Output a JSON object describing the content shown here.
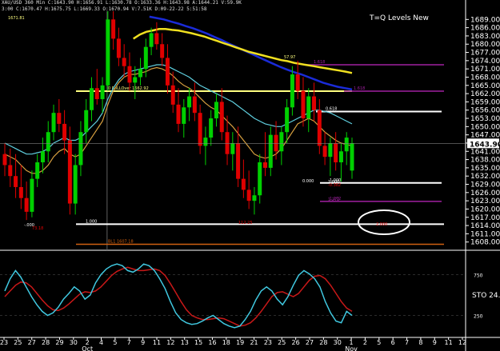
{
  "header": {
    "line1": "XAU/USD 360 Min  C:1643.90  H:1656.91  L:1630.78  O:1633.36  H:1643.98  A:1644.21  V:59.9K",
    "line2": "3:00  C:1670.47  H:1675.75  L:1669.33  O:1670.94  V:7.51K  D:09-22-22  5:51:58"
  },
  "title": "T=Q Levels New",
  "colors": {
    "background": "#000000",
    "bull": "#00d000",
    "bear": "#e00000",
    "ma_blue": "#1a2bd8",
    "ma_yellow": "#f0e020",
    "ma_orange": "#d8a040",
    "ma_cyan": "#60d0e0",
    "stoch_k": "#40c8e0",
    "stoch_d": "#c81818",
    "level_white": "#ffffff",
    "level_magenta": "#a020a0",
    "level_yellow": "#ffff80",
    "level_orange": "#d06010",
    "ellipse": "#ffffff",
    "grid": "#3a3a3a",
    "axis_text": "#ffffff",
    "price_box_bg": "#ffffff",
    "price_box_text": "#000000"
  },
  "chart_data": {
    "type": "candlestick",
    "y_axis": {
      "ticks": [
        1689,
        1686,
        1683,
        1680,
        1677,
        1674,
        1671,
        1668,
        1665,
        1662,
        1659,
        1656,
        1653,
        1650,
        1647,
        1644,
        1641,
        1638,
        1635,
        1632,
        1629,
        1626,
        1623,
        1620,
        1617,
        1614,
        1611,
        1608
      ],
      "tick_labels": [
        "1689.00",
        "1686.00",
        "1683.00",
        "1680.00",
        "1677.00",
        "1674.00",
        "1671.00",
        "1668.00",
        "1665.00",
        "1662.00",
        "1659.00",
        "1656.00",
        "1653.00",
        "1650.00",
        "1647.00",
        "1644.00",
        "1641.00",
        "1638.00",
        "1635.00",
        "1632.00",
        "1629.00",
        "1626.00",
        "1623.00",
        "1620.00",
        "1617.00",
        "1614.00",
        "1611.00",
        "1608.00"
      ],
      "range": [
        1605,
        1692
      ]
    },
    "x_axis": {
      "day_labels": [
        "23",
        "25",
        "27",
        "28",
        "29",
        "30",
        "2",
        "4",
        "5",
        "7",
        "9",
        "11",
        "12",
        "13",
        "15",
        "16",
        "18",
        "19",
        "21",
        "23",
        "25",
        "26",
        "27",
        "28",
        "30",
        "1",
        "2",
        "5",
        "6",
        "7",
        "8",
        "9",
        "11",
        "12"
      ],
      "month_labels": [
        "Oct",
        "Nov"
      ],
      "month_positions_day_index": [
        6,
        25
      ]
    },
    "last_price": "1643.90",
    "candles": [
      [
        1640,
        1644,
        1632,
        1636
      ],
      [
        1636,
        1642,
        1628,
        1632
      ],
      [
        1632,
        1640,
        1624,
        1628
      ],
      [
        1628,
        1636,
        1620,
        1624
      ],
      [
        1624,
        1630,
        1616,
        1619
      ],
      [
        1619,
        1634,
        1617,
        1631
      ],
      [
        1631,
        1640,
        1628,
        1637
      ],
      [
        1637,
        1646,
        1633,
        1641
      ],
      [
        1641,
        1652,
        1637,
        1648
      ],
      [
        1648,
        1658,
        1645,
        1655
      ],
      [
        1655,
        1660,
        1648,
        1651
      ],
      [
        1651,
        1656,
        1640,
        1645
      ],
      [
        1645,
        1650,
        1618,
        1622
      ],
      [
        1622,
        1640,
        1618,
        1636
      ],
      [
        1636,
        1652,
        1632,
        1648
      ],
      [
        1648,
        1660,
        1644,
        1656
      ],
      [
        1656,
        1668,
        1652,
        1664
      ],
      [
        1664,
        1671,
        1658,
        1660
      ],
      [
        1660,
        1668,
        1655,
        1665
      ],
      [
        1665,
        1692,
        1663,
        1689
      ],
      [
        1689,
        1692,
        1678,
        1682
      ],
      [
        1682,
        1686,
        1672,
        1675
      ],
      [
        1675,
        1680,
        1668,
        1672
      ],
      [
        1672,
        1677,
        1663,
        1666
      ],
      [
        1666,
        1672,
        1660,
        1668
      ],
      [
        1668,
        1675,
        1665,
        1671
      ],
      [
        1671,
        1682,
        1668,
        1679
      ],
      [
        1679,
        1686,
        1676,
        1684
      ],
      [
        1684,
        1688,
        1678,
        1680
      ],
      [
        1680,
        1684,
        1672,
        1675
      ],
      [
        1675,
        1680,
        1662,
        1665
      ],
      [
        1665,
        1670,
        1655,
        1658
      ],
      [
        1658,
        1664,
        1648,
        1651
      ],
      [
        1651,
        1660,
        1646,
        1657
      ],
      [
        1657,
        1664,
        1652,
        1661
      ],
      [
        1661,
        1666,
        1652,
        1655
      ],
      [
        1655,
        1658,
        1640,
        1643
      ],
      [
        1643,
        1650,
        1636,
        1646
      ],
      [
        1646,
        1656,
        1643,
        1653
      ],
      [
        1653,
        1662,
        1650,
        1659
      ],
      [
        1659,
        1664,
        1645,
        1648
      ],
      [
        1648,
        1654,
        1636,
        1640
      ],
      [
        1640,
        1648,
        1634,
        1644
      ],
      [
        1644,
        1650,
        1628,
        1631
      ],
      [
        1631,
        1638,
        1624,
        1627
      ],
      [
        1627,
        1634,
        1620,
        1623
      ],
      [
        1623,
        1628,
        1618,
        1625
      ],
      [
        1625,
        1640,
        1622,
        1637
      ],
      [
        1637,
        1648,
        1632,
        1635
      ],
      [
        1635,
        1650,
        1632,
        1647
      ],
      [
        1647,
        1652,
        1638,
        1641
      ],
      [
        1641,
        1650,
        1636,
        1648
      ],
      [
        1648,
        1660,
        1644,
        1657
      ],
      [
        1657,
        1672,
        1654,
        1669
      ],
      [
        1669,
        1674,
        1660,
        1663
      ],
      [
        1663,
        1668,
        1650,
        1653
      ],
      [
        1653,
        1664,
        1648,
        1661
      ],
      [
        1661,
        1666,
        1652,
        1656
      ],
      [
        1656,
        1660,
        1640,
        1643
      ],
      [
        1643,
        1648,
        1636,
        1639
      ],
      [
        1639,
        1646,
        1632,
        1644
      ],
      [
        1644,
        1648,
        1634,
        1637
      ],
      [
        1637,
        1644,
        1630,
        1641
      ],
      [
        1641,
        1648,
        1636,
        1646
      ],
      [
        1634,
        1646,
        1631,
        1644
      ]
    ],
    "moving_averages": [
      {
        "color_key": "ma_blue",
        "values": [
          null,
          null,
          null,
          null,
          null,
          null,
          null,
          null,
          null,
          null,
          null,
          null,
          null,
          null,
          null,
          null,
          null,
          null,
          null,
          null,
          1690,
          1689.5,
          1689,
          1688.2,
          1687.5,
          1686.6,
          1685.8,
          1684.8,
          1683.8,
          1682.6,
          1681.5,
          1680.2,
          1679,
          1677.8,
          1676.6,
          1675.4,
          1674.2,
          1673,
          1671.8,
          1670.8,
          1669.8,
          1669,
          1668,
          1667,
          1666,
          1665.2,
          1664.5,
          1664,
          1663.5
        ]
      },
      {
        "color_key": "ma_yellow",
        "values": [
          null,
          null,
          null,
          null,
          null,
          null,
          null,
          null,
          null,
          null,
          null,
          null,
          null,
          null,
          null,
          null,
          null,
          null,
          null,
          null,
          1682,
          1683.5,
          1684.5,
          1685,
          1685.5,
          1685.5,
          1685.2,
          1685,
          1684.5,
          1684,
          1683.4,
          1682.8,
          1682,
          1681.2,
          1680.4,
          1679.6,
          1678.8,
          1678,
          1677.2,
          1676.6,
          1676,
          1675.4,
          1674.8,
          1674.2,
          1673.8,
          1673.2,
          1672.8,
          1672.4,
          1672,
          1671.6,
          1671.2,
          1670.8,
          1670.4,
          1670,
          1669.5
        ]
      },
      {
        "color_key": "ma_cyan",
        "values": [
          1644,
          1643,
          1642,
          1641,
          1640,
          1640,
          1640.5,
          1641,
          1642,
          1644,
          1645,
          1646,
          1645,
          1645,
          1646,
          1648,
          1650,
          1652,
          1655,
          1660,
          1664,
          1667,
          1669,
          1670,
          1670.5,
          1671,
          1671.5,
          1672,
          1672.5,
          1672.5,
          1672,
          1671,
          1670,
          1669,
          1668,
          1666.5,
          1665,
          1664,
          1663,
          1662,
          1661,
          1660,
          1659,
          1657.5,
          1656,
          1654.5,
          1653,
          1652,
          1651,
          1650.5,
          1650,
          1650,
          1651,
          1652,
          1653,
          1654,
          1655,
          1656,
          1656,
          1655.5,
          1655,
          1654,
          1653,
          1652,
          1651
        ]
      },
      {
        "color_key": "ma_orange",
        "values": [
          1640,
          1639,
          1638,
          1636,
          1634,
          1633,
          1633,
          1634,
          1636,
          1639,
          1641,
          1642,
          1640,
          1639,
          1640,
          1643,
          1646,
          1649,
          1652,
          1658,
          1663,
          1666,
          1668,
          1669,
          1669,
          1669.5,
          1670,
          1671,
          1671.5,
          1671,
          1670,
          1668.5,
          1666.5,
          1665,
          1664,
          1662.5,
          1660.5,
          1658.5,
          1657,
          1656,
          1654,
          1652,
          1650,
          1647.5,
          1645,
          1642.5,
          1640,
          1639,
          1638.5,
          1639,
          1640,
          1642,
          1645,
          1648,
          1651,
          1652,
          1653,
          1652,
          1650,
          1648,
          1646.5,
          1645,
          1644,
          1643.5,
          1643
        ]
      }
    ],
    "levels": [
      {
        "label": "1.000",
        "price": 1614.5,
        "color_key": "level_white"
      },
      {
        "label": "0 RoLLOver 1662.92",
        "price": 1662.92,
        "color_key": "level_white"
      },
      {
        "label": "1.618",
        "price": 1672.5,
        "color_key": "level_magenta"
      },
      {
        "label": "1.618",
        "price": 1662.92,
        "color_key": "level_magenta"
      },
      {
        "label": "0.618",
        "price": 1655.5,
        "color_key": "level_white"
      },
      {
        "label": "1.000",
        "price": 1629.5,
        "color_key": "level_white"
      },
      {
        "label": "1.272",
        "price": 1622.8,
        "color_key": "level_magenta"
      },
      {
        "label": "BL1 1607.18",
        "price": 1607.18,
        "color_key": "level_orange"
      }
    ],
    "annotations": [
      "1671.81",
      "57.97",
      "73.18",
      "-.000",
      "0.000",
      "112.25",
      "-0.382",
      "1.000",
      "1.272",
      "2.000",
      "BL1 1607.18"
    ],
    "stochastic": {
      "label": "STO",
      "value_label": "24.",
      "k_values": [
        55,
        70,
        80,
        72,
        60,
        48,
        38,
        30,
        25,
        28,
        35,
        45,
        52,
        60,
        55,
        45,
        50,
        65,
        75,
        82,
        86,
        88,
        86,
        80,
        78,
        82,
        88,
        86,
        80,
        70,
        58,
        42,
        28,
        20,
        16,
        14,
        15,
        18,
        22,
        25,
        20,
        15,
        12,
        10,
        12,
        20,
        30,
        44,
        55,
        60,
        55,
        45,
        38,
        48,
        62,
        74,
        80,
        76,
        70,
        60,
        42,
        28,
        18,
        16,
        30,
        25
      ],
      "d_values": [
        48,
        55,
        62,
        66,
        65,
        60,
        52,
        44,
        37,
        32,
        31,
        34,
        39,
        45,
        51,
        54,
        53,
        55,
        60,
        67,
        74,
        79,
        82,
        84,
        82,
        80,
        80,
        81,
        82,
        80,
        74,
        64,
        53,
        42,
        32,
        25,
        22,
        20,
        20,
        21,
        22,
        21,
        18,
        15,
        12,
        13,
        16,
        22,
        30,
        39,
        48,
        53,
        54,
        51,
        48,
        52,
        60,
        68,
        73,
        74,
        70,
        62,
        52,
        42,
        34,
        30
      ],
      "levels": [
        75,
        25
      ],
      "level_labels": [
        "750",
        "250"
      ]
    }
  }
}
